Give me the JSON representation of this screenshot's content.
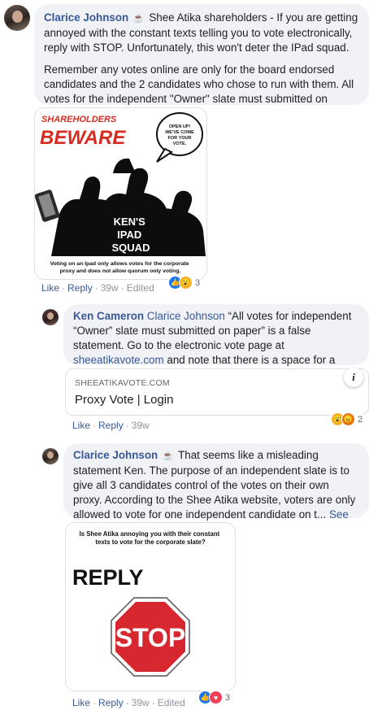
{
  "comments": [
    {
      "author": "Clarice Johnson",
      "text_p1": "Shee Atika shareholders - If you are getting annoyed with the constant texts telling you to vote electronically, reply with STOP. Unfortunately, this won't deter the IPad squad.",
      "text_p2": "Remember any votes online are only for the board endorsed candidates and the 2 candidates who chose to run with them. All votes for the independent \"Owner\" slate must submitted on paper.",
      "image": {
        "header_line1": "SHAREHOLDERS",
        "header_line2": "BEWARE",
        "speech": "OPEN UP! WE'VE COME FOR YOUR VOTE.",
        "squad_line1": "KEN'S",
        "squad_line2": "IPAD",
        "squad_line3": "SQUAD",
        "caption": "Voting on an Ipad only allows votes for the corporate proxy and does not allow quorum only voting."
      },
      "actions": {
        "like": "Like",
        "reply": "Reply",
        "time": "39w",
        "edited": "Edited"
      },
      "reaction_count": "3"
    },
    {
      "author": "Ken Cameron",
      "mention": "Clarice Johnson",
      "text_a": "“All votes for independent “Owner” slate must submitted on paper” is a false statement. Go to the electronic vote page at ",
      "link_text": "sheeatikavote.com",
      "text_b": " and note that there is a space for a write in candidate.",
      "link_card": {
        "domain": "SHEEATIKAVOTE.COM",
        "title": "Proxy Vote | Login",
        "info_icon": "i"
      },
      "actions": {
        "like": "Like",
        "reply": "Reply",
        "time": "39w"
      },
      "reaction_count": "2"
    },
    {
      "author": "Clarice Johnson",
      "text": "That seems like a misleading statement Ken. The purpose of an independent slate is to give all 3 candidates control of the votes on their own proxy. According to the Shee Atika website, voters are only allowed to vote for one independent candidate on t...",
      "see_more": "See more",
      "image": {
        "question": "Is Shee Atika annoying you with their constant texts to vote for the corporate slate?",
        "reply_word": "REPLY",
        "stop_word": "STOP"
      },
      "actions": {
        "like": "Like",
        "reply": "Reply",
        "time": "39w",
        "edited": "Edited"
      },
      "reaction_count": "3"
    }
  ],
  "colors": {
    "link_blue": "#385898",
    "bubble_gray": "#f0f2f5",
    "stop_red": "#d7282f",
    "beware_red": "#d62b1f"
  },
  "icons": [
    "coffee-icon",
    "like-reaction-icon",
    "wow-reaction-icon",
    "angry-reaction-icon",
    "love-reaction-icon",
    "info-icon"
  ]
}
